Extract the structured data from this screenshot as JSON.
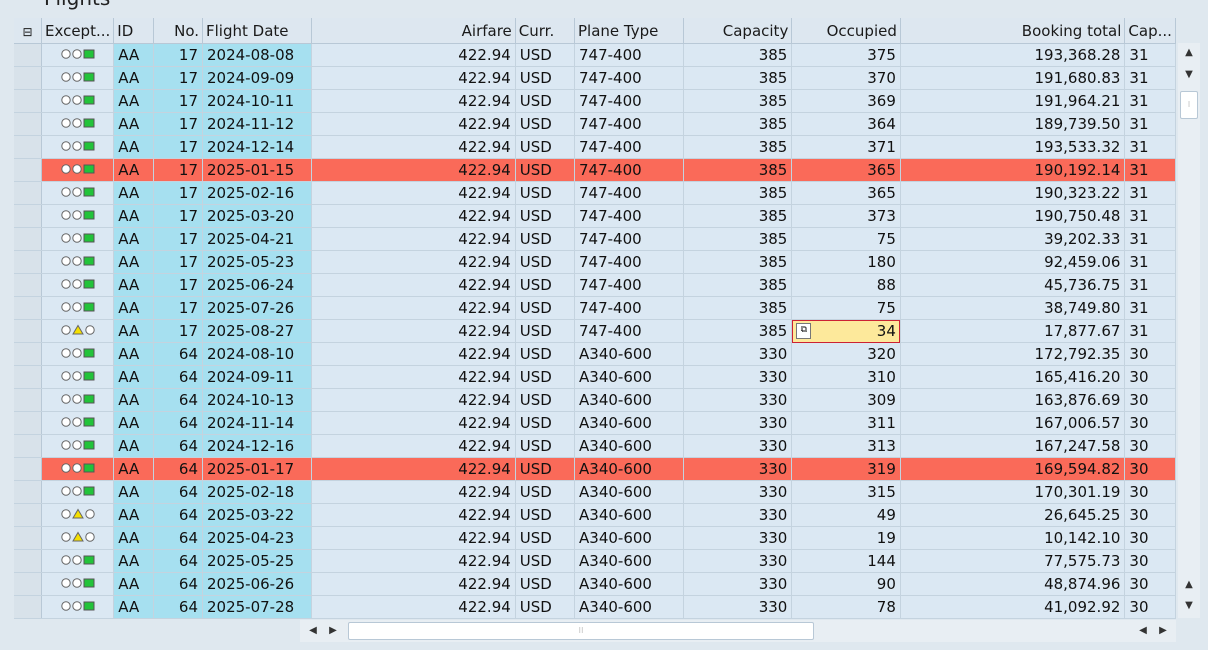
{
  "window": {
    "title": "Flights"
  },
  "columns": [
    "Except...",
    "ID",
    "No.",
    "Flight Date",
    "Airfare",
    "Curr.",
    "Plane Type",
    "Capacity",
    "Occupied",
    "Booking total",
    "Cap..."
  ],
  "rows": [
    {
      "exc": "green",
      "id": "AA",
      "no": "17",
      "date": "2024-08-08",
      "fare": "422.94",
      "curr": "USD",
      "plane": "747-400",
      "cap": "385",
      "occ": "375",
      "total": "193,368.28",
      "cap2": "31"
    },
    {
      "exc": "green",
      "id": "AA",
      "no": "17",
      "date": "2024-09-09",
      "fare": "422.94",
      "curr": "USD",
      "plane": "747-400",
      "cap": "385",
      "occ": "370",
      "total": "191,680.83",
      "cap2": "31"
    },
    {
      "exc": "green",
      "id": "AA",
      "no": "17",
      "date": "2024-10-11",
      "fare": "422.94",
      "curr": "USD",
      "plane": "747-400",
      "cap": "385",
      "occ": "369",
      "total": "191,964.21",
      "cap2": "31"
    },
    {
      "exc": "green",
      "id": "AA",
      "no": "17",
      "date": "2024-11-12",
      "fare": "422.94",
      "curr": "USD",
      "plane": "747-400",
      "cap": "385",
      "occ": "364",
      "total": "189,739.50",
      "cap2": "31"
    },
    {
      "exc": "green",
      "id": "AA",
      "no": "17",
      "date": "2024-12-14",
      "fare": "422.94",
      "curr": "USD",
      "plane": "747-400",
      "cap": "385",
      "occ": "371",
      "total": "193,533.32",
      "cap2": "31"
    },
    {
      "exc": "green",
      "id": "AA",
      "no": "17",
      "date": "2025-01-15",
      "fare": "422.94",
      "curr": "USD",
      "plane": "747-400",
      "cap": "385",
      "occ": "365",
      "total": "190,192.14",
      "cap2": "31",
      "highlight": true
    },
    {
      "exc": "green",
      "id": "AA",
      "no": "17",
      "date": "2025-02-16",
      "fare": "422.94",
      "curr": "USD",
      "plane": "747-400",
      "cap": "385",
      "occ": "365",
      "total": "190,323.22",
      "cap2": "31"
    },
    {
      "exc": "green",
      "id": "AA",
      "no": "17",
      "date": "2025-03-20",
      "fare": "422.94",
      "curr": "USD",
      "plane": "747-400",
      "cap": "385",
      "occ": "373",
      "total": "190,750.48",
      "cap2": "31"
    },
    {
      "exc": "green",
      "id": "AA",
      "no": "17",
      "date": "2025-04-21",
      "fare": "422.94",
      "curr": "USD",
      "plane": "747-400",
      "cap": "385",
      "occ": "75",
      "total": "39,202.33",
      "cap2": "31"
    },
    {
      "exc": "green",
      "id": "AA",
      "no": "17",
      "date": "2025-05-23",
      "fare": "422.94",
      "curr": "USD",
      "plane": "747-400",
      "cap": "385",
      "occ": "180",
      "total": "92,459.06",
      "cap2": "31"
    },
    {
      "exc": "green",
      "id": "AA",
      "no": "17",
      "date": "2025-06-24",
      "fare": "422.94",
      "curr": "USD",
      "plane": "747-400",
      "cap": "385",
      "occ": "88",
      "total": "45,736.75",
      "cap2": "31"
    },
    {
      "exc": "green",
      "id": "AA",
      "no": "17",
      "date": "2025-07-26",
      "fare": "422.94",
      "curr": "USD",
      "plane": "747-400",
      "cap": "385",
      "occ": "75",
      "total": "38,749.80",
      "cap2": "31"
    },
    {
      "exc": "yellow",
      "id": "AA",
      "no": "17",
      "date": "2025-08-27",
      "fare": "422.94",
      "curr": "USD",
      "plane": "747-400",
      "cap": "385",
      "occ": "34",
      "total": "17,877.67",
      "cap2": "31",
      "focus": true
    },
    {
      "exc": "green",
      "id": "AA",
      "no": "64",
      "date": "2024-08-10",
      "fare": "422.94",
      "curr": "USD",
      "plane": "A340-600",
      "cap": "330",
      "occ": "320",
      "total": "172,792.35",
      "cap2": "30"
    },
    {
      "exc": "green",
      "id": "AA",
      "no": "64",
      "date": "2024-09-11",
      "fare": "422.94",
      "curr": "USD",
      "plane": "A340-600",
      "cap": "330",
      "occ": "310",
      "total": "165,416.20",
      "cap2": "30"
    },
    {
      "exc": "green",
      "id": "AA",
      "no": "64",
      "date": "2024-10-13",
      "fare": "422.94",
      "curr": "USD",
      "plane": "A340-600",
      "cap": "330",
      "occ": "309",
      "total": "163,876.69",
      "cap2": "30"
    },
    {
      "exc": "green",
      "id": "AA",
      "no": "64",
      "date": "2024-11-14",
      "fare": "422.94",
      "curr": "USD",
      "plane": "A340-600",
      "cap": "330",
      "occ": "311",
      "total": "167,006.57",
      "cap2": "30"
    },
    {
      "exc": "green",
      "id": "AA",
      "no": "64",
      "date": "2024-12-16",
      "fare": "422.94",
      "curr": "USD",
      "plane": "A340-600",
      "cap": "330",
      "occ": "313",
      "total": "167,247.58",
      "cap2": "30"
    },
    {
      "exc": "green",
      "id": "AA",
      "no": "64",
      "date": "2025-01-17",
      "fare": "422.94",
      "curr": "USD",
      "plane": "A340-600",
      "cap": "330",
      "occ": "319",
      "total": "169,594.82",
      "cap2": "30",
      "highlight": true
    },
    {
      "exc": "green",
      "id": "AA",
      "no": "64",
      "date": "2025-02-18",
      "fare": "422.94",
      "curr": "USD",
      "plane": "A340-600",
      "cap": "330",
      "occ": "315",
      "total": "170,301.19",
      "cap2": "30"
    },
    {
      "exc": "yellow",
      "id": "AA",
      "no": "64",
      "date": "2025-03-22",
      "fare": "422.94",
      "curr": "USD",
      "plane": "A340-600",
      "cap": "330",
      "occ": "49",
      "total": "26,645.25",
      "cap2": "30"
    },
    {
      "exc": "yellow",
      "id": "AA",
      "no": "64",
      "date": "2025-04-23",
      "fare": "422.94",
      "curr": "USD",
      "plane": "A340-600",
      "cap": "330",
      "occ": "19",
      "total": "10,142.10",
      "cap2": "30"
    },
    {
      "exc": "green",
      "id": "AA",
      "no": "64",
      "date": "2025-05-25",
      "fare": "422.94",
      "curr": "USD",
      "plane": "A340-600",
      "cap": "330",
      "occ": "144",
      "total": "77,575.73",
      "cap2": "30"
    },
    {
      "exc": "green",
      "id": "AA",
      "no": "64",
      "date": "2025-06-26",
      "fare": "422.94",
      "curr": "USD",
      "plane": "A340-600",
      "cap": "330",
      "occ": "90",
      "total": "48,874.96",
      "cap2": "30"
    },
    {
      "exc": "green",
      "id": "AA",
      "no": "64",
      "date": "2025-07-28",
      "fare": "422.94",
      "curr": "USD",
      "plane": "A340-600",
      "cap": "330",
      "occ": "78",
      "total": "41,092.92",
      "cap2": "30"
    }
  ],
  "icons": {
    "exception_green": "traffic-light-green-icon",
    "exception_yellow": "traffic-light-yellow-icon",
    "layout": "layout-menu-icon",
    "cell_button": "cell-value-help-icon"
  },
  "colors": {
    "key": "#a6e0f0",
    "highlight": "#fa6a59",
    "focus": "#fde99b",
    "green": "#22c33a",
    "yellow": "#f5e000"
  }
}
